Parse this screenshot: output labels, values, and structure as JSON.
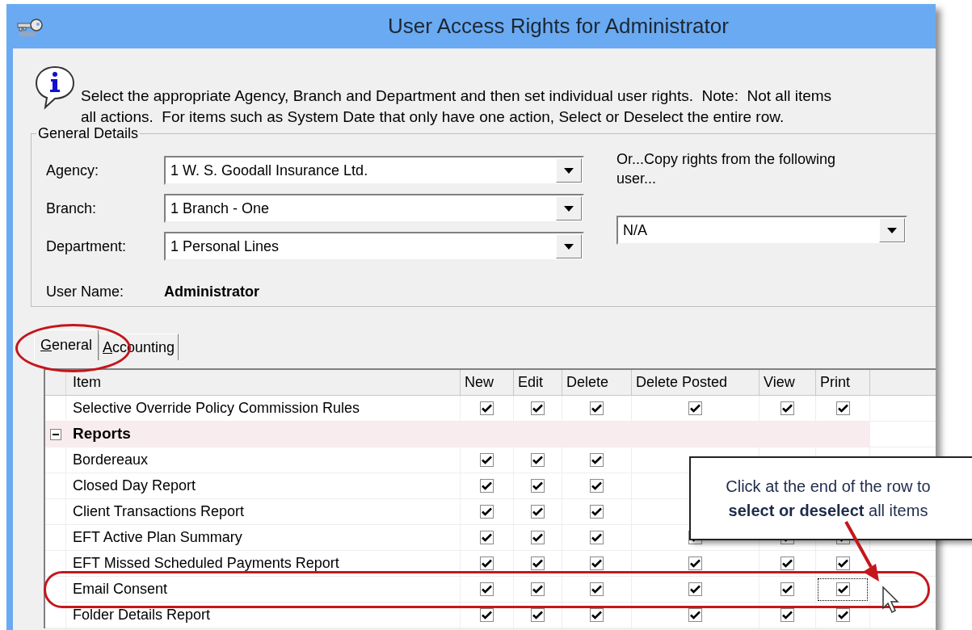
{
  "window": {
    "title": "User Access Rights for Administrator"
  },
  "info": {
    "text": "Select the appropriate Agency, Branch and Department and then set individual user rights.  Note:  Not all items",
    "text_2": "all actions.  For items such as System Date that only have one action, Select or Deselect the entire row."
  },
  "general_details": {
    "title": "General Details",
    "fields": [
      {
        "label": "Agency:",
        "value": "1 W. S. Goodall Insurance Ltd."
      },
      {
        "label": "Branch:",
        "value": "1 Branch - One"
      },
      {
        "label": "Department:",
        "value": "1 Personal Lines"
      }
    ],
    "user_name_label": "User Name:",
    "user_name": "Administrator",
    "copy_label": "Or...Copy rights from the following user...",
    "copy_value": "N/A"
  },
  "tabs": [
    {
      "label": "General",
      "selected": true
    },
    {
      "label": "Accounting",
      "selected": false
    }
  ],
  "table": {
    "columns": [
      "Item",
      "New",
      "Edit",
      "Delete",
      "Delete Posted",
      "View",
      "Print"
    ],
    "rows": [
      {
        "kind": "item",
        "label": "Selective Override Policy Commission Rules",
        "focused": false,
        "checks": [
          true,
          true,
          true,
          true,
          true,
          true
        ]
      },
      {
        "kind": "group",
        "label": "Reports",
        "expanded": true
      },
      {
        "kind": "item",
        "label": "Bordereaux",
        "focused": false,
        "checks": [
          true,
          true,
          true
        ]
      },
      {
        "kind": "item",
        "label": "Closed Day Report",
        "focused": false,
        "checks": [
          true,
          true,
          true
        ]
      },
      {
        "kind": "item",
        "label": "Client Transactions Report",
        "focused": false,
        "checks": [
          true,
          true,
          true
        ]
      },
      {
        "kind": "item",
        "label": "EFT Active Plan Summary",
        "focused": false,
        "checks": [
          true,
          true,
          true,
          true,
          true,
          true
        ]
      },
      {
        "kind": "item",
        "label": "EFT Missed Scheduled Payments Report",
        "focused": false,
        "checks": [
          true,
          true,
          true,
          true,
          true,
          true
        ]
      },
      {
        "kind": "item",
        "label": "Email Consent",
        "focused": true,
        "checks": [
          true,
          true,
          true,
          true,
          true,
          true
        ]
      },
      {
        "kind": "item",
        "label": "Folder Details Report",
        "focused": false,
        "checks": [
          true,
          true,
          true,
          true,
          true,
          true
        ]
      }
    ]
  },
  "callout": {
    "text": "Click at the end of the row to **select or deselect** all items"
  }
}
